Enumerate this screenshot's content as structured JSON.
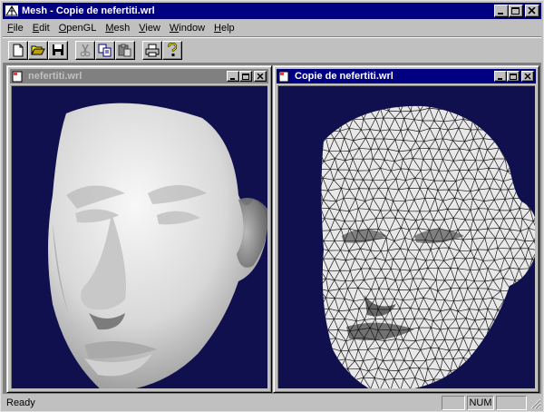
{
  "app": {
    "title": "Mesh - Copie de nefertiti.wrl"
  },
  "menu": [
    {
      "label": "File",
      "accel": "F",
      "rest": "ile"
    },
    {
      "label": "Edit",
      "accel": "E",
      "rest": "dit"
    },
    {
      "label": "OpenGL",
      "accel": "O",
      "rest": "penGL"
    },
    {
      "label": "Mesh",
      "accel": "M",
      "rest": "esh"
    },
    {
      "label": "View",
      "accel": "V",
      "rest": "iew"
    },
    {
      "label": "Window",
      "accel": "W",
      "rest": "indow"
    },
    {
      "label": "Help",
      "accel": "H",
      "rest": "elp"
    }
  ],
  "toolbar": {
    "buttons": [
      "new-file",
      "open-folder",
      "save-disk",
      "cut",
      "copy",
      "paste",
      "print",
      "help"
    ]
  },
  "windows": {
    "left": {
      "title": "nefertiti.wrl",
      "render": "smooth-shaded"
    },
    "right": {
      "title": "Copie de nefertiti.wrl",
      "render": "wireframe"
    }
  },
  "status": {
    "text": "Ready",
    "pane1": "",
    "num": "NUM",
    "pane3": ""
  },
  "colors": {
    "titlebar_active": "#000080",
    "titlebar_inactive": "#808080",
    "viewport_bg": "#10104f",
    "face": "#c0c0c0"
  }
}
